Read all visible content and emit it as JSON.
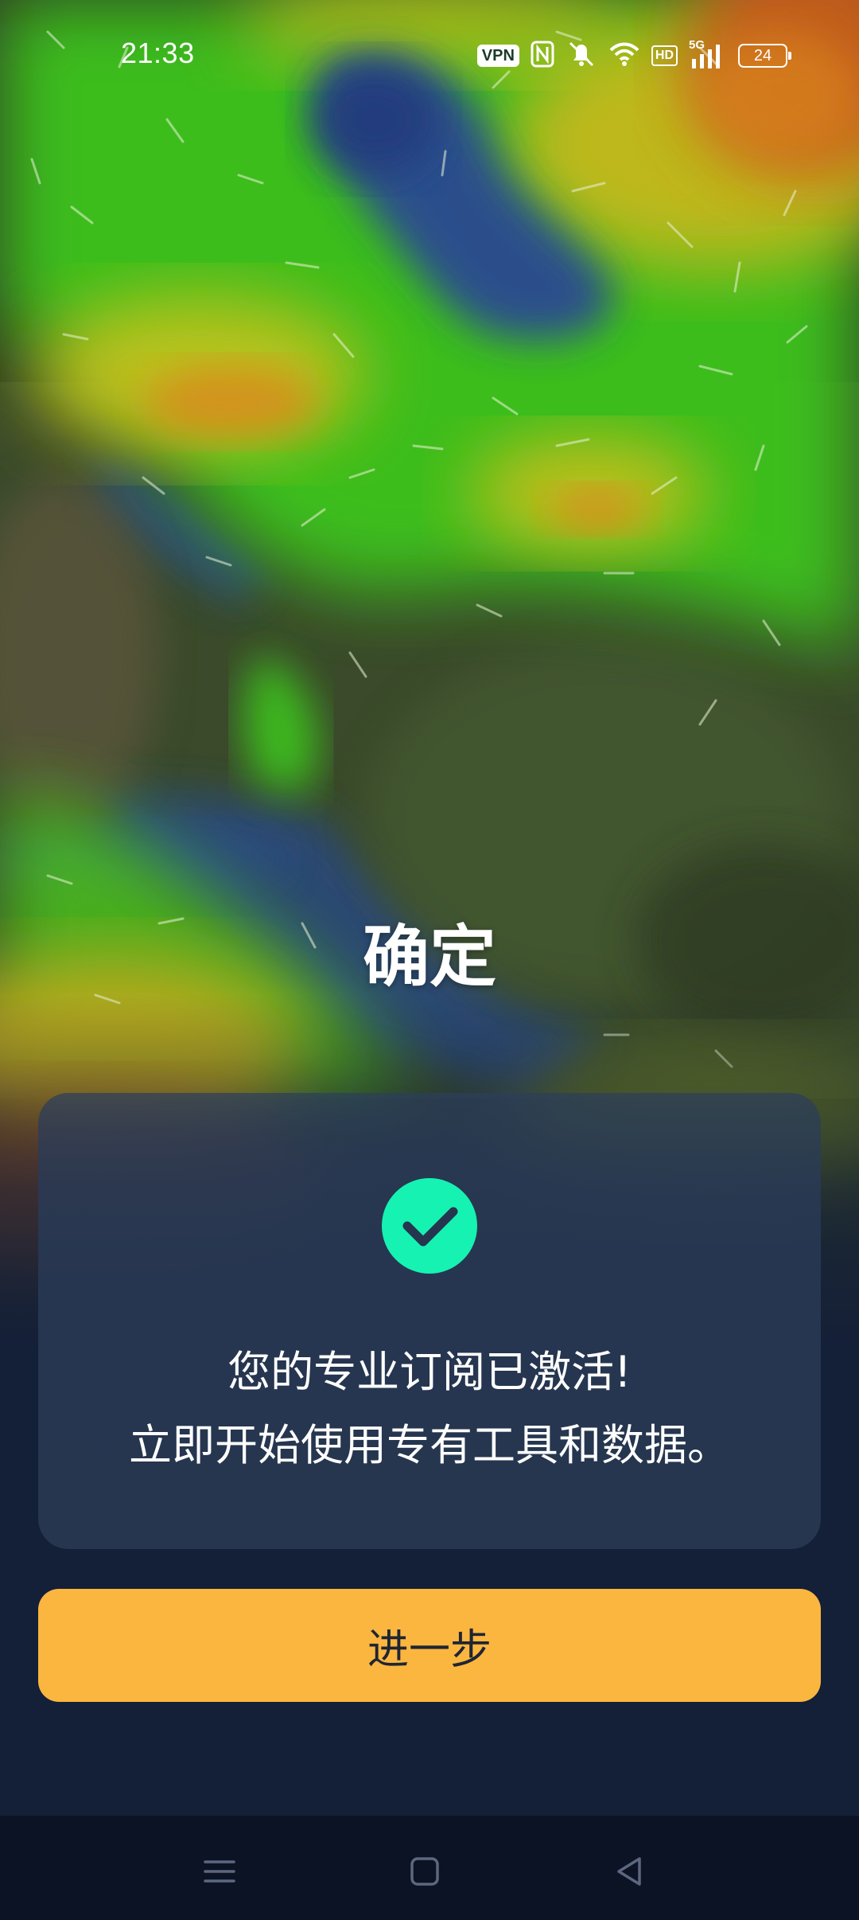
{
  "status_bar": {
    "time": "21:33",
    "vpn_label": "VPN",
    "hd_label": "HD",
    "network_label": "5G",
    "battery_level": "24",
    "icons": [
      "nfc-icon",
      "mute-icon",
      "wifi-icon",
      "signal-icon"
    ]
  },
  "main": {
    "title": "确定",
    "card": {
      "icon": "check-circle-icon",
      "line1": "您的专业订阅已激活!",
      "line2": "立即开始使用专有工具和数据。"
    },
    "next_button_label": "进一步"
  },
  "nav_bar": {
    "icons": [
      "menu-icon",
      "home-icon",
      "back-icon"
    ]
  },
  "colors": {
    "accent": "#fbb640",
    "check": "#16f2b2",
    "background": "#141f38",
    "card": "#26364f"
  }
}
